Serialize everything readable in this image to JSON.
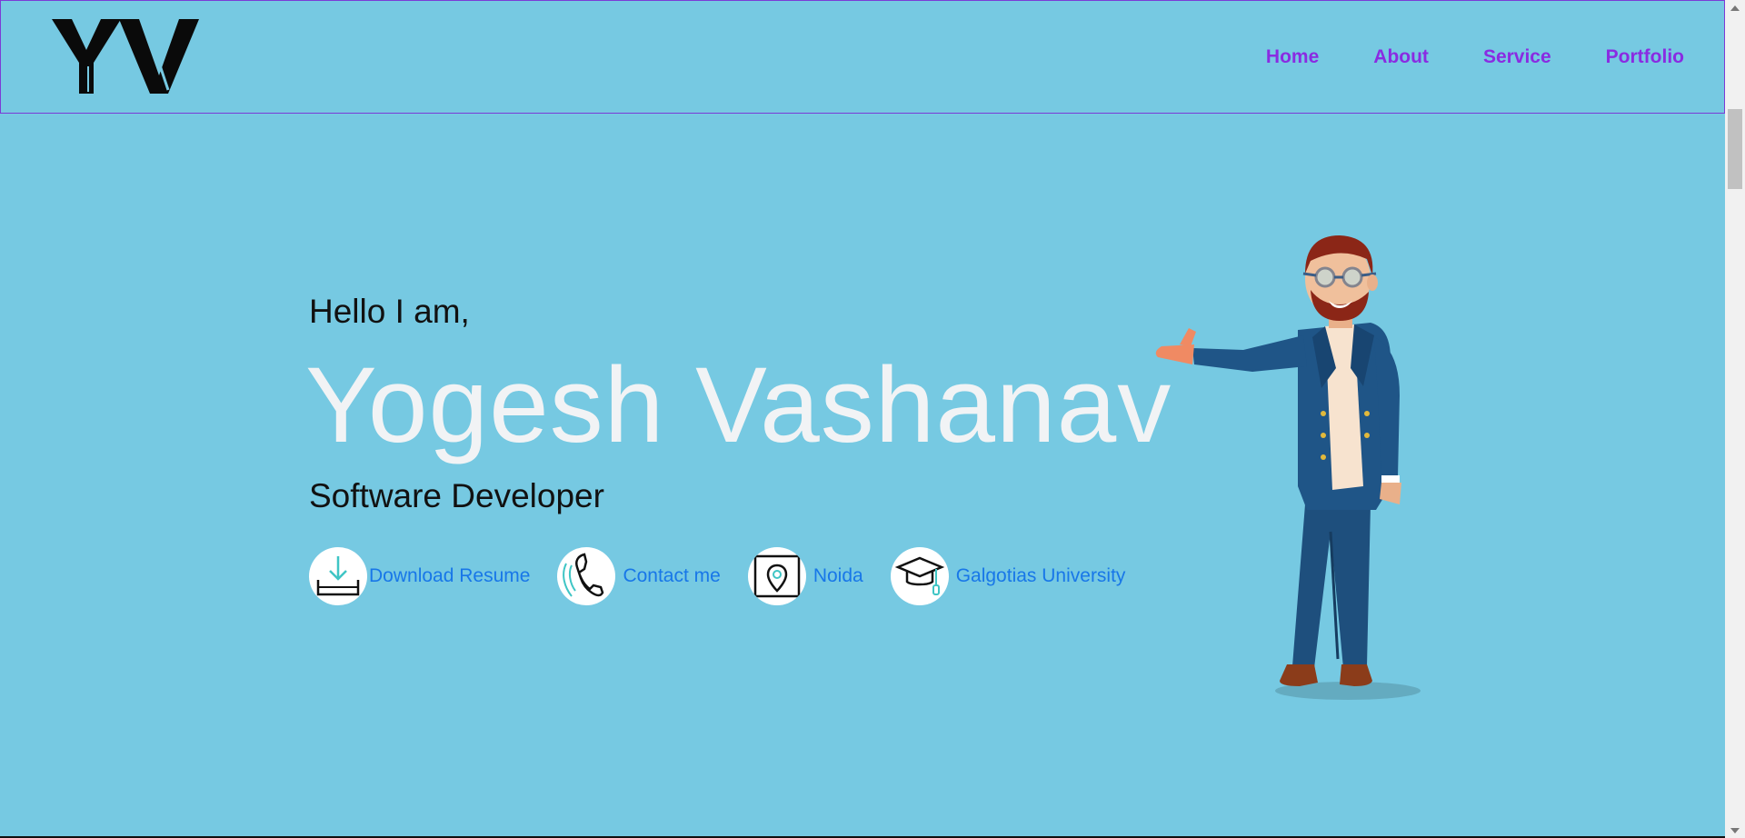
{
  "header": {
    "logo_text": "YV",
    "nav": [
      "Home",
      "About",
      "Service",
      "Portfolio"
    ]
  },
  "hero": {
    "greeting": "Hello I am,",
    "name": "Yogesh Vashanav",
    "role": "Software Developer",
    "links": {
      "resume": "Download Resume",
      "contact": "Contact me",
      "location": "Noida",
      "university": "Galgotias University"
    }
  },
  "icons": {
    "resume": "download-icon",
    "contact": "phone-icon",
    "location": "map-pin-icon",
    "university": "graduation-cap-icon"
  },
  "colors": {
    "background": "#76c9e2",
    "nav_link": "#8a2be2",
    "name_text": "#f1f3f5",
    "link_text": "#1877e8"
  }
}
